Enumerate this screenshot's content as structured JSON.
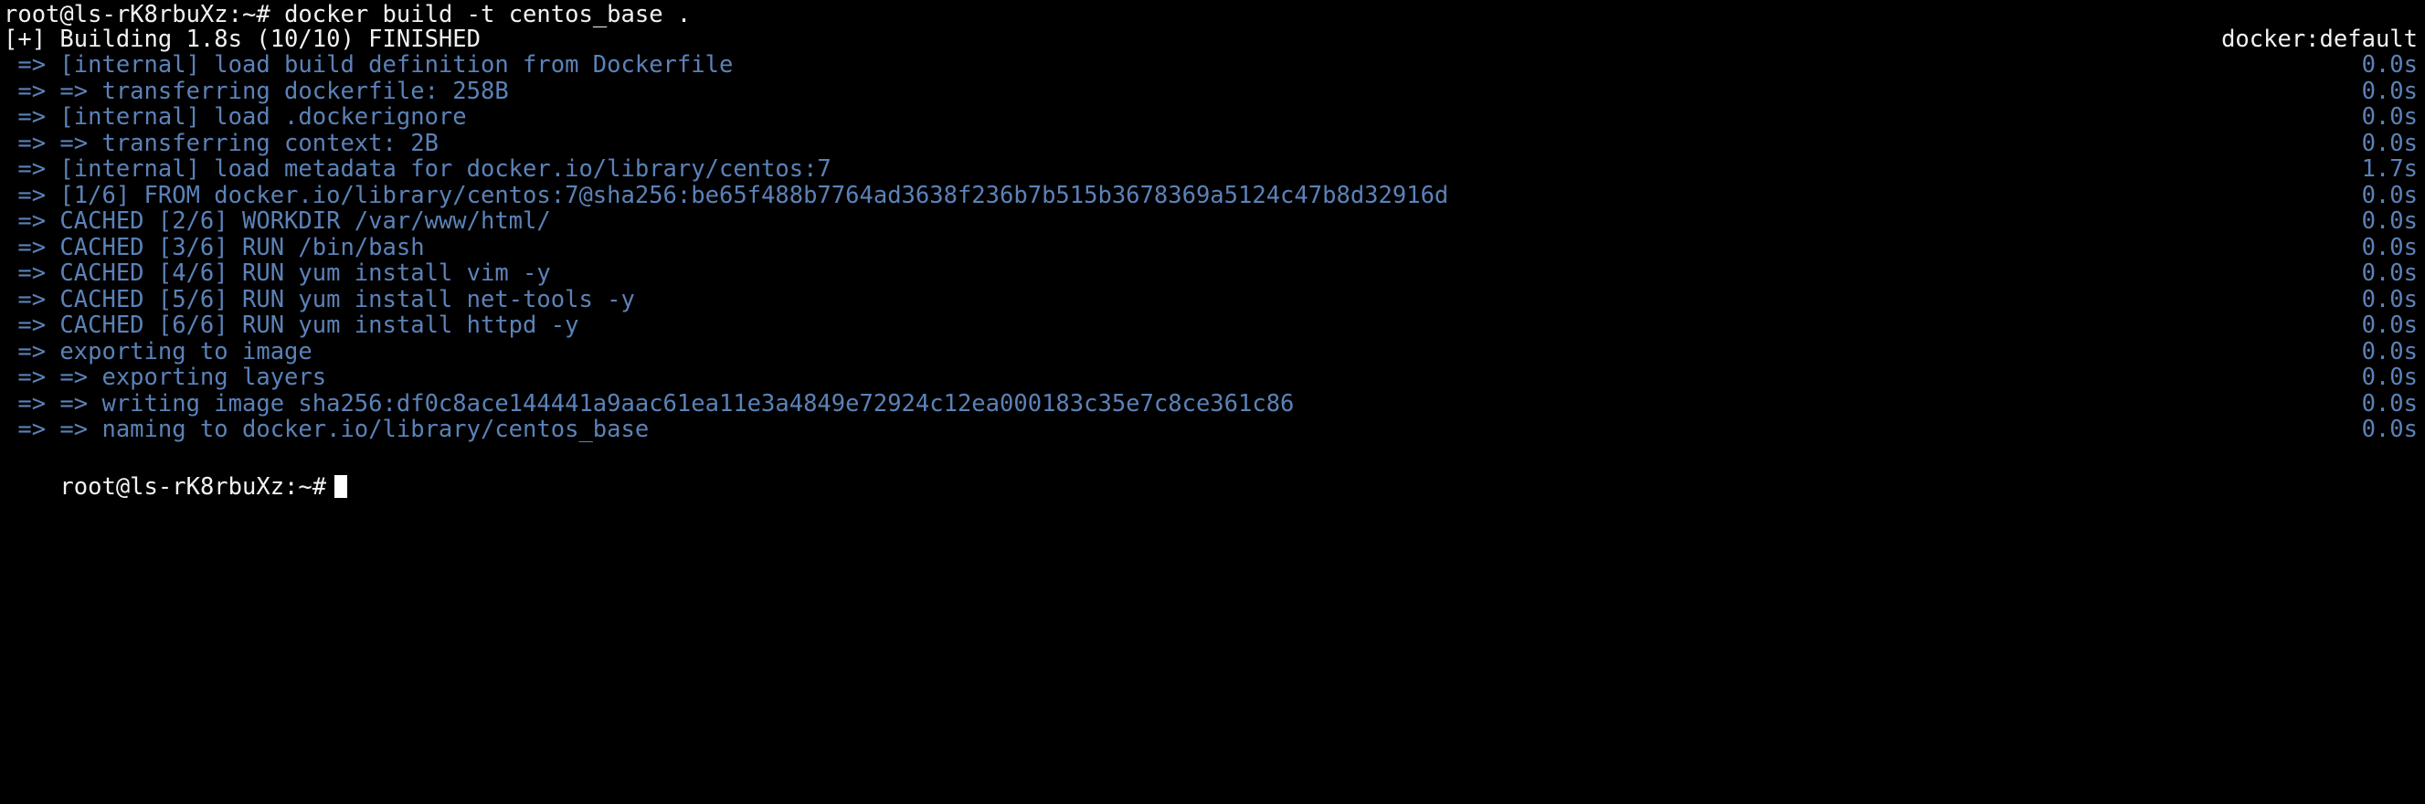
{
  "terminal": {
    "colors": {
      "background": "#000000",
      "foreground": "#f2f2f2",
      "step_blue": "#5b82b8",
      "cursor": "#ffffff"
    },
    "prompt": "root@ls-rK8rbuXz:~#",
    "command": "docker build -t centos_base .",
    "summary": {
      "text": "[+] Building 1.8s (10/10) FINISHED",
      "driver": "docker:default"
    },
    "steps": [
      {
        "text": " => [internal] load build definition from Dockerfile",
        "time": "0.0s"
      },
      {
        "text": " => => transferring dockerfile: 258B",
        "time": "0.0s"
      },
      {
        "text": " => [internal] load .dockerignore",
        "time": "0.0s"
      },
      {
        "text": " => => transferring context: 2B",
        "time": "0.0s"
      },
      {
        "text": " => [internal] load metadata for docker.io/library/centos:7",
        "time": "1.7s"
      },
      {
        "text": " => [1/6] FROM docker.io/library/centos:7@sha256:be65f488b7764ad3638f236b7b515b3678369a5124c47b8d32916d",
        "time": "0.0s"
      },
      {
        "text": " => CACHED [2/6] WORKDIR /var/www/html/",
        "time": "0.0s"
      },
      {
        "text": " => CACHED [3/6] RUN /bin/bash",
        "time": "0.0s"
      },
      {
        "text": " => CACHED [4/6] RUN yum install vim -y",
        "time": "0.0s"
      },
      {
        "text": " => CACHED [5/6] RUN yum install net-tools -y",
        "time": "0.0s"
      },
      {
        "text": " => CACHED [6/6] RUN yum install httpd -y",
        "time": "0.0s"
      },
      {
        "text": " => exporting to image",
        "time": "0.0s"
      },
      {
        "text": " => => exporting layers",
        "time": "0.0s"
      },
      {
        "text": " => => writing image sha256:df0c8ace144441a9aac61ea11e3a4849e72924c12ea000183c35e7c8ce361c86",
        "time": "0.0s"
      },
      {
        "text": " => => naming to docker.io/library/centos_base",
        "time": "0.0s"
      }
    ],
    "final_prompt": "root@ls-rK8rbuXz:~#"
  }
}
